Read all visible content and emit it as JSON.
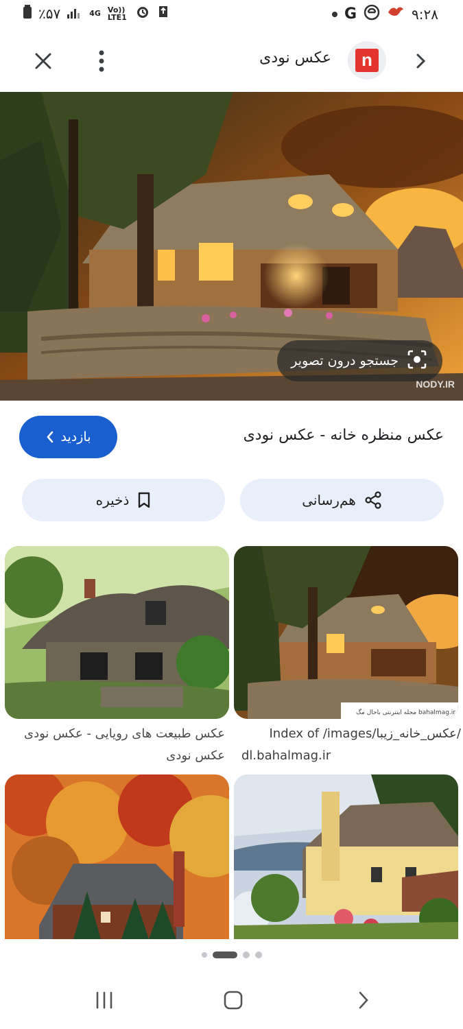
{
  "status_bar": {
    "time": "۹:۲۸",
    "battery": "٪۵۷",
    "network": "4G",
    "volte": "Vo)) LTE1",
    "icons": [
      "g-icon",
      "edge-icon",
      "bird-app-icon",
      "alarm-icon",
      "signal-icon",
      "battery-icon"
    ]
  },
  "app_bar": {
    "site_logo_letter": "n",
    "site_name": "عکس نودی",
    "brand_color": "#e3352b"
  },
  "hero": {
    "lens_chip_label": "جستجو درون تصویر",
    "watermark": "NODY.IR"
  },
  "result": {
    "title": "عکس منظره خانه - عکس نودی",
    "visit_label": "بازدید",
    "share_label": "هم‌رسانی",
    "save_label": "ذخیره",
    "accent_color": "#1a5fd0"
  },
  "related": [
    {
      "caption_line1": "/عکس_خانه_زیبا/Index of /images",
      "caption_line2": "dl.bahalmag.ir",
      "image_watermark": "bahalmag.ir مجله اینترنتی باحال مگ"
    },
    {
      "caption_line1": "عکس طبیعت های رویایی - عکس نودی",
      "caption_line2": "عکس نودی"
    },
    {},
    {}
  ],
  "pagination": {
    "current": 2,
    "total": 4
  }
}
